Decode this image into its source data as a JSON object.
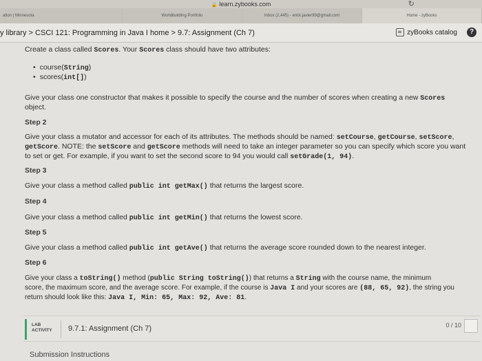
{
  "browser": {
    "url": "learn.zybooks.com",
    "tabs": [
      {
        "label": "ation | Minnesota"
      },
      {
        "label": "Worldbuilding Portfolio"
      },
      {
        "label": "Inbox (2,445) - erick.javier99@gmail.com"
      },
      {
        "label": "Home - zyBooks"
      }
    ]
  },
  "header": {
    "breadcrumb": "y library > CSCI 121: Programming in Java I home > 9.7: Assignment (Ch 7)",
    "catalog_label": "zyBooks catalog",
    "help_label": "?"
  },
  "content": {
    "intro": [
      "Create a class called ",
      "Scores",
      ". Your ",
      "Scores",
      " class should have two attributes:"
    ],
    "attributes": [
      [
        "course(",
        "String",
        ")"
      ],
      [
        "scores(",
        "int[]",
        ")"
      ]
    ],
    "constructor_l1": [
      "Give your class one constructor that makes it possible to specify the course and the number of scores when creating a new ",
      "Scores"
    ],
    "constructor_l2": "object.",
    "step2": "Step 2",
    "step2_l1": [
      "Give your class a mutator and accessor for each of its attributes. The methods should be named: ",
      "setCourse",
      ", ",
      "getCourse",
      ", ",
      "setScore",
      ","
    ],
    "step2_l2": [
      "getScore",
      ". NOTE: the ",
      "setScore",
      " and ",
      "getScore",
      " methods will need to take an integer parameter so you can specify which score you want"
    ],
    "step2_l3": [
      "to set or get. For example, if you want to set the second score to 94 you would call ",
      "setGrade(1, 94)",
      "."
    ],
    "step3": "Step 3",
    "step3_text": [
      "Give your class a method called ",
      "public int getMax()",
      " that returns the largest score."
    ],
    "step4": "Step 4",
    "step4_text": [
      "Give your class a method called ",
      "public int getMin()",
      " that returns the lowest score."
    ],
    "step5": "Step 5",
    "step5_text": [
      "Give your class a method called ",
      "public int getAve()",
      " that returns the average score rounded down to the nearest integer."
    ],
    "step6": "Step 6",
    "step6_l1": [
      "Give your class a ",
      "toString()",
      " method (",
      "public String toString()",
      ") that returns a ",
      "String",
      " with the course name, the minimum"
    ],
    "step6_l2": [
      "score, the maximum score, and the average score. For example, if the course is ",
      "Java I",
      " and your scores are ",
      "(88, 65, 92)",
      ", the string you"
    ],
    "step6_l3": [
      "return should look like this: ",
      "Java I, Min: 65, Max: 92, Ave: 81",
      "."
    ]
  },
  "lab": {
    "tag_l1": "LAB",
    "tag_l2": "ACTIVITY",
    "title": "9.7.1: Assignment (Ch 7)",
    "score": "0 / 10"
  },
  "submission_label": "Submission Instructions"
}
